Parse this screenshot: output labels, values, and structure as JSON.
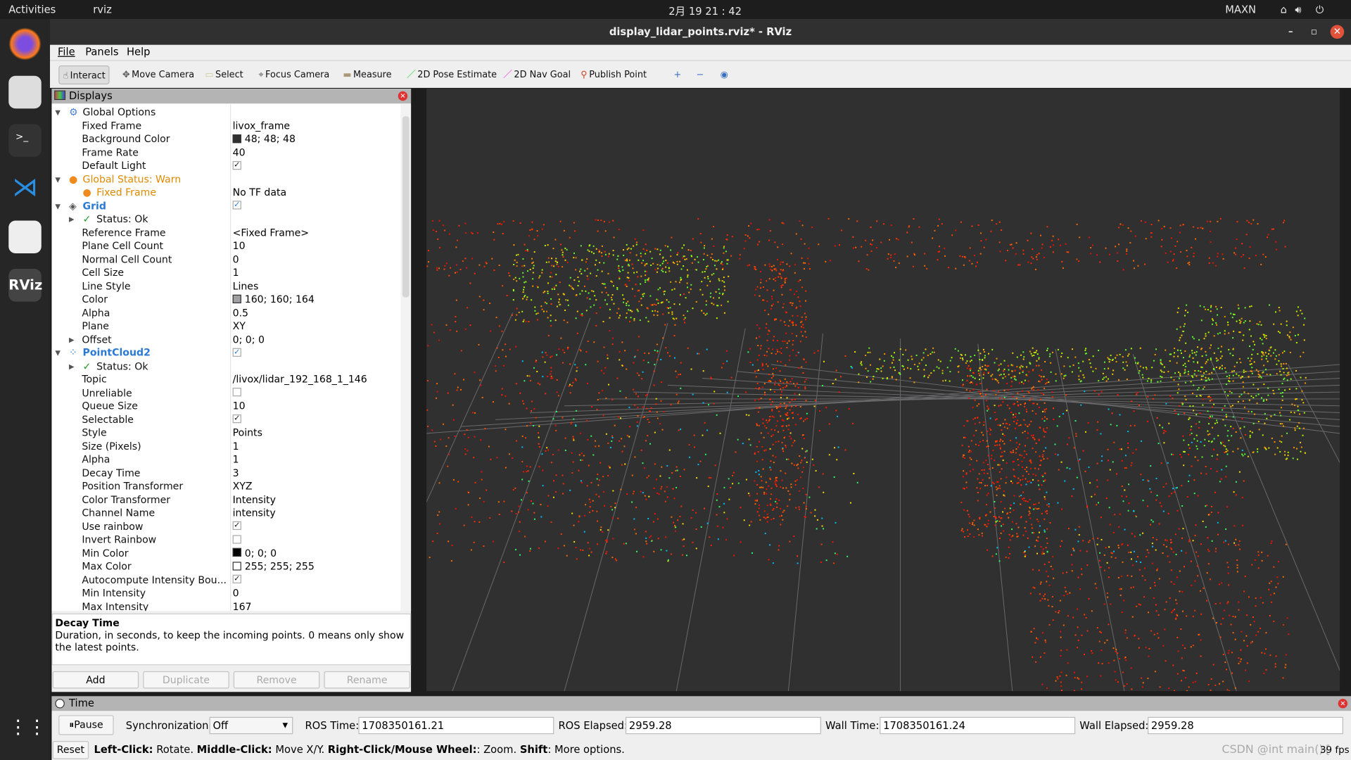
{
  "system": {
    "activities": "Activities",
    "app_menu": "rviz",
    "clock": "2月 19  21 : 42",
    "power_mode": "MAXN"
  },
  "window": {
    "title": "display_lidar_points.rviz* - RViz"
  },
  "menu": [
    "File",
    "Panels",
    "Help"
  ],
  "toolbar": {
    "tools": [
      {
        "label": "Interact",
        "icon": "hand-icon",
        "active": true
      },
      {
        "label": "Move Camera",
        "icon": "move-camera-icon"
      },
      {
        "label": "Select",
        "icon": "select-icon"
      },
      {
        "label": "Focus Camera",
        "icon": "focus-camera-icon"
      },
      {
        "label": "Measure",
        "icon": "ruler-icon"
      },
      {
        "label": "2D Pose Estimate",
        "icon": "green-arrow-icon"
      },
      {
        "label": "2D Nav Goal",
        "icon": "magenta-arrow-icon"
      },
      {
        "label": "Publish Point",
        "icon": "map-pin-icon"
      }
    ]
  },
  "displays": {
    "title": "Displays",
    "rows": [
      {
        "label": "Global Options",
        "level": 0,
        "icon": "gear-icon",
        "expand": "open"
      },
      {
        "label": "Fixed Frame",
        "level": 1,
        "value": "livox_frame"
      },
      {
        "label": "Background Color",
        "level": 1,
        "value": "48; 48; 48",
        "swatch": "#303030"
      },
      {
        "label": "Frame Rate",
        "level": 1,
        "value": "40"
      },
      {
        "label": "Default Light",
        "level": 1,
        "check": true
      },
      {
        "label": "Global Status: Warn",
        "level": 0,
        "icon": "warning-icon",
        "expand": "open",
        "style": "warn"
      },
      {
        "label": "Fixed Frame",
        "level": 1,
        "icon": "warning-icon",
        "style": "warn",
        "value": "No TF data"
      },
      {
        "label": "Grid",
        "level": 0,
        "icon": "grid-icon",
        "expand": "open",
        "style": "display",
        "check": true
      },
      {
        "label": "Status: Ok",
        "level": 1,
        "icon": "checkmark-icon",
        "expand": "closed"
      },
      {
        "label": "Reference Frame",
        "level": 1,
        "value": "<Fixed Frame>"
      },
      {
        "label": "Plane Cell Count",
        "level": 1,
        "value": "10"
      },
      {
        "label": "Normal Cell Count",
        "level": 1,
        "value": "0"
      },
      {
        "label": "Cell Size",
        "level": 1,
        "value": "1"
      },
      {
        "label": "Line Style",
        "level": 1,
        "value": "Lines"
      },
      {
        "label": "Color",
        "level": 1,
        "value": "160; 160; 164",
        "swatch": "#a0a0a4"
      },
      {
        "label": "Alpha",
        "level": 1,
        "value": "0.5"
      },
      {
        "label": "Plane",
        "level": 1,
        "value": "XY"
      },
      {
        "label": "Offset",
        "level": 1,
        "value": "0; 0; 0",
        "expand": "closed"
      },
      {
        "label": "PointCloud2",
        "level": 0,
        "icon": "pointcloud-icon",
        "expand": "open",
        "style": "display",
        "check": true
      },
      {
        "label": "Status: Ok",
        "level": 1,
        "icon": "checkmark-icon",
        "expand": "closed"
      },
      {
        "label": "Topic",
        "level": 1,
        "value": "/livox/lidar_192_168_1_146"
      },
      {
        "label": "Unreliable",
        "level": 1,
        "check": false
      },
      {
        "label": "Queue Size",
        "level": 1,
        "value": "10"
      },
      {
        "label": "Selectable",
        "level": 1,
        "check": true
      },
      {
        "label": "Style",
        "level": 1,
        "value": "Points"
      },
      {
        "label": "Size (Pixels)",
        "level": 1,
        "value": "1"
      },
      {
        "label": "Alpha",
        "level": 1,
        "value": "1"
      },
      {
        "label": "Decay Time",
        "level": 1,
        "value": "3"
      },
      {
        "label": "Position Transformer",
        "level": 1,
        "value": "XYZ"
      },
      {
        "label": "Color Transformer",
        "level": 1,
        "value": "Intensity"
      },
      {
        "label": "Channel Name",
        "level": 1,
        "value": "intensity"
      },
      {
        "label": "Use rainbow",
        "level": 1,
        "check": true
      },
      {
        "label": "Invert Rainbow",
        "level": 1,
        "check": false
      },
      {
        "label": "Min Color",
        "level": 1,
        "value": "0; 0; 0",
        "swatch": "#000000"
      },
      {
        "label": "Max Color",
        "level": 1,
        "value": "255; 255; 255",
        "swatch": "#ffffff"
      },
      {
        "label": "Autocompute Intensity Bou...",
        "level": 1,
        "check": true
      },
      {
        "label": "Min Intensity",
        "level": 1,
        "value": "0"
      },
      {
        "label": "Max Intensity",
        "level": 1,
        "value": "167"
      }
    ],
    "description": {
      "title": "Decay Time",
      "text": "Duration, in seconds, to keep the incoming points. 0 means only show the latest points."
    },
    "buttons": {
      "add": "Add",
      "duplicate": "Duplicate",
      "remove": "Remove",
      "rename": "Rename"
    }
  },
  "colors": {
    "warn": "#e08a00",
    "display": "#2a7ad5",
    "ok": "#2a9a2a",
    "background": "#303030"
  },
  "time": {
    "title": "Time",
    "pause": "Pause",
    "sync_label": "Synchronization:",
    "sync_value": "Off",
    "ros_time_label": "ROS Time:",
    "ros_time": "1708350161.21",
    "ros_elapsed_label": "ROS Elapsed:",
    "ros_elapsed": "2959.28",
    "wall_time_label": "Wall Time:",
    "wall_time": "1708350161.24",
    "wall_elapsed_label": "Wall Elapsed:",
    "wall_elapsed": "2959.28"
  },
  "status": {
    "reset": "Reset",
    "k1": "Left-Click:",
    "t1": " Rotate. ",
    "k2": "Middle-Click:",
    "t2": " Move X/Y. ",
    "k3": "Right-Click/Mouse Wheel:",
    "t3": ": Zoom. ",
    "k4": "Shift",
    "t4": ": More options.",
    "fps": "39 fps",
    "watermark": "CSDN @int main(){"
  }
}
